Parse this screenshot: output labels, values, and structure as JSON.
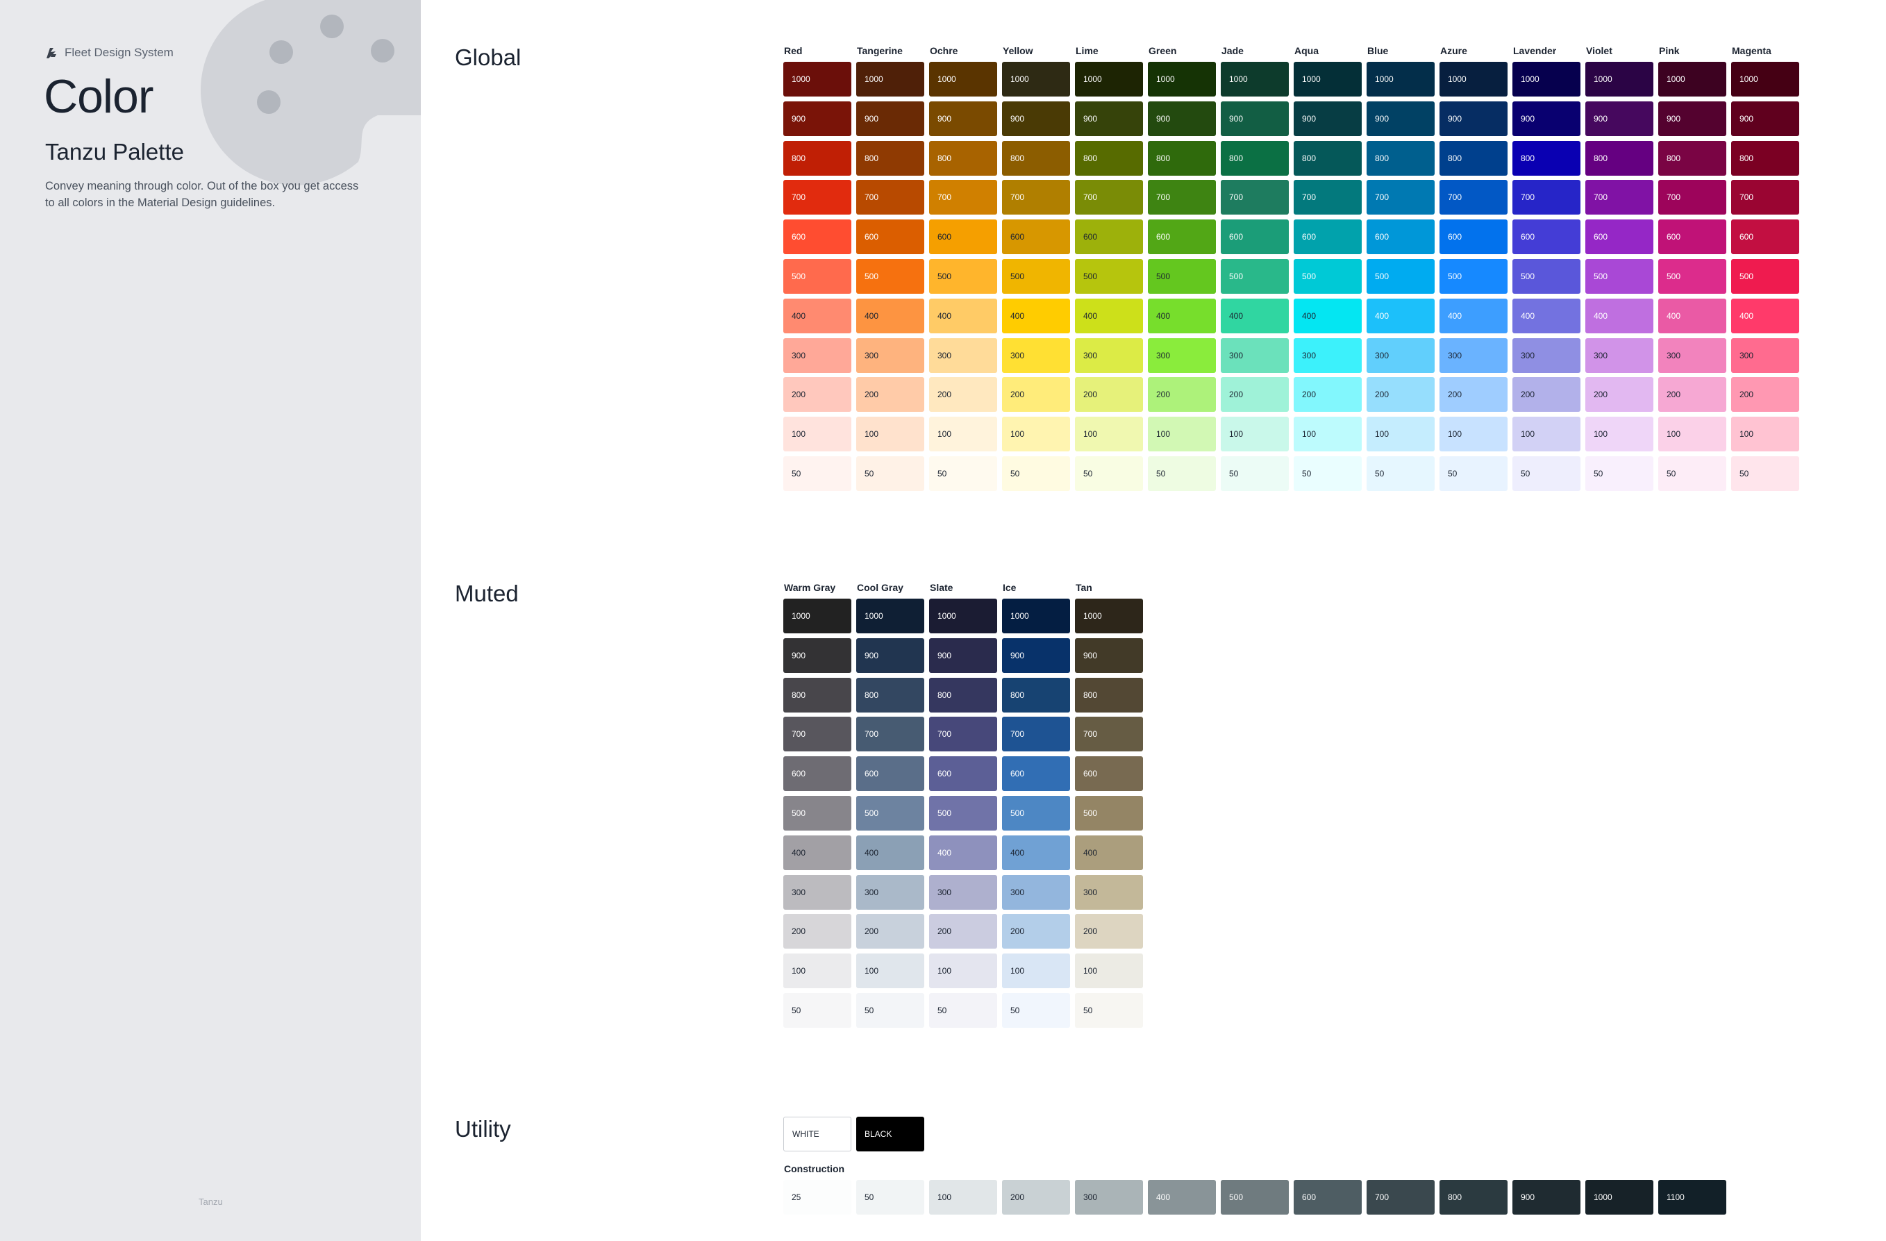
{
  "sidebar": {
    "brand": "Fleet Design System",
    "title": "Color",
    "subtitle": "Tanzu Palette",
    "description": "Convey meaning through color. Out of the box you get access to all colors in the Material Design guidelines.",
    "footer": "Tanzu"
  },
  "sections": {
    "global": "Global",
    "muted": "Muted",
    "utility": "Utility"
  },
  "steps": [
    "1000",
    "900",
    "800",
    "700",
    "600",
    "500",
    "400",
    "300",
    "200",
    "100",
    "50"
  ],
  "global": [
    {
      "name": "Red",
      "colors": [
        "#6b0f0a",
        "#7a1408",
        "#c01f05",
        "#e12b0e",
        "#ff4d30",
        "#ff6a4d",
        "#ff8a70",
        "#ffa898",
        "#ffc8bd",
        "#ffe3dd",
        "#fff3f0"
      ]
    },
    {
      "name": "Tangerine",
      "colors": [
        "#4f2008",
        "#6a2a05",
        "#8f3a02",
        "#b84a00",
        "#db5e00",
        "#f6710f",
        "#fd9441",
        "#feb37e",
        "#ffcba8",
        "#ffe2cd",
        "#fff2e7"
      ]
    },
    {
      "name": "Ochre",
      "colors": [
        "#5a3400",
        "#7a4a00",
        "#a86300",
        "#d08000",
        "#f59f00",
        "#ffb52c",
        "#ffcb66",
        "#ffdb99",
        "#ffe8bf",
        "#fff3dc",
        "#fffaef"
      ]
    },
    {
      "name": "Yellow",
      "colors": [
        "#2e2a14",
        "#4a3a05",
        "#8c5d00",
        "#b07f00",
        "#d79700",
        "#f0b500",
        "#ffcc00",
        "#ffe033",
        "#ffec7a",
        "#fff4b0",
        "#fffbe1"
      ]
    },
    {
      "name": "Lime",
      "colors": [
        "#1d2403",
        "#36430a",
        "#576b00",
        "#7a8c06",
        "#9db10b",
        "#b6c50d",
        "#cde01a",
        "#dceb46",
        "#e6f17a",
        "#f0f8b0",
        "#f9fde3"
      ]
    },
    {
      "name": "Green",
      "colors": [
        "#153305",
        "#234a0f",
        "#2f6a0c",
        "#3e8412",
        "#52a716",
        "#64c71f",
        "#77de2c",
        "#8aec3c",
        "#adf27a",
        "#d2f8b4",
        "#eefce2"
      ]
    },
    {
      "name": "Jade",
      "colors": [
        "#0d3b2c",
        "#125e44",
        "#0b7044",
        "#1e7c5f",
        "#1b9d78",
        "#29b88a",
        "#30d6a1",
        "#6be1bb",
        "#9ff2d8",
        "#c9f8ea",
        "#ecfcf6"
      ]
    },
    {
      "name": "Aqua",
      "colors": [
        "#042f37",
        "#073d44",
        "#055859",
        "#03797d",
        "#01a2ac",
        "#00c9d6",
        "#04e6f2",
        "#3cf1fb",
        "#82f7fd",
        "#bdfbfd",
        "#eafeff"
      ]
    },
    {
      "name": "Blue",
      "colors": [
        "#032e4a",
        "#014164",
        "#005f8e",
        "#0079b2",
        "#0097d8",
        "#00abf0",
        "#1cc0fa",
        "#61cffc",
        "#96defd",
        "#c5edfe",
        "#e6f7ff"
      ]
    },
    {
      "name": "Azure",
      "colors": [
        "#071f3f",
        "#062d63",
        "#00408d",
        "#0258c5",
        "#0272ed",
        "#1689ff",
        "#3d9eff",
        "#6ab3ff",
        "#9fcdff",
        "#c8e2ff",
        "#e8f3ff"
      ]
    },
    {
      "name": "Lavender",
      "colors": [
        "#06004e",
        "#090070",
        "#0a00b2",
        "#2625c8",
        "#443dd6",
        "#5a57da",
        "#7372e0",
        "#8f8fe3",
        "#b2b1ea",
        "#d2d1f5",
        "#eeeefd"
      ]
    },
    {
      "name": "Violet",
      "colors": [
        "#2b0445",
        "#46085e",
        "#650081",
        "#8012a5",
        "#9527c6",
        "#a948d6",
        "#bf6fe0",
        "#d193e8",
        "#e2b8f1",
        "#efd6f8",
        "#f9f0fd"
      ]
    },
    {
      "name": "Pink",
      "colors": [
        "#3d0221",
        "#54022f",
        "#7a0444",
        "#9d045b",
        "#c01277",
        "#dc2c8c",
        "#ea5aa5",
        "#f283bd",
        "#f6a8d3",
        "#fbd1e8",
        "#fdedf7"
      ]
    },
    {
      "name": "Magenta",
      "colors": [
        "#450014",
        "#60001e",
        "#7b0023",
        "#9a0532",
        "#c20f41",
        "#ef1b4f",
        "#ff3a6a",
        "#ff6b8f",
        "#ff98b2",
        "#ffc3d2",
        "#ffe5ec"
      ]
    }
  ],
  "muted": [
    {
      "name": "Warm Gray",
      "colors": [
        "#222222",
        "#333234",
        "#48464b",
        "#58565d",
        "#6e6c73",
        "#87858b",
        "#a2a0a5",
        "#bcbbbf",
        "#d7d6d9",
        "#ebebed",
        "#f6f6f7"
      ]
    },
    {
      "name": "Cool Gray",
      "colors": [
        "#0f1f34",
        "#213550",
        "#334761",
        "#475b72",
        "#5a6e89",
        "#6d83a0",
        "#8ba0b5",
        "#aab9c9",
        "#c8d1dc",
        "#e0e6ec",
        "#f3f5f8"
      ]
    },
    {
      "name": "Slate",
      "colors": [
        "#1b1c33",
        "#2a2b4d",
        "#35375f",
        "#47487a",
        "#5c5f96",
        "#7073a8",
        "#8e91bd",
        "#aeb0ce",
        "#cbcce0",
        "#e4e5ef",
        "#f3f3f8"
      ]
    },
    {
      "name": "Ice",
      "colors": [
        "#041e42",
        "#08326a",
        "#174372",
        "#1e5393",
        "#316eb4",
        "#4d87c4",
        "#70a1d4",
        "#93b6dd",
        "#b3cee9",
        "#d9e6f5",
        "#f1f6fd"
      ]
    },
    {
      "name": "Tan",
      "colors": [
        "#2d261a",
        "#423a28",
        "#534834",
        "#665c44",
        "#786a51",
        "#948565",
        "#ab9e7d",
        "#c3b899",
        "#ddd5c1",
        "#ecebe4",
        "#f7f6f2"
      ]
    }
  ],
  "utility": {
    "white_label": "WHITE",
    "black_label": "BLACK",
    "construction_label": "Construction",
    "construction": [
      {
        "label": "25",
        "color": "#fcfdfd"
      },
      {
        "label": "50",
        "color": "#f1f4f5"
      },
      {
        "label": "100",
        "color": "#e1e6e8"
      },
      {
        "label": "200",
        "color": "#c9d1d4"
      },
      {
        "label": "300",
        "color": "#aab4b7"
      },
      {
        "label": "400",
        "color": "#899498"
      },
      {
        "label": "500",
        "color": "#6f7b7f"
      },
      {
        "label": "600",
        "color": "#4e5d63"
      },
      {
        "label": "700",
        "color": "#3a484e"
      },
      {
        "label": "800",
        "color": "#2b3a40"
      },
      {
        "label": "900",
        "color": "#1f2b31"
      },
      {
        "label": "1000",
        "color": "#172228"
      },
      {
        "label": "1100",
        "color": "#122028"
      }
    ]
  },
  "colors": {
    "sidebar_bg": "#e8e9ec",
    "palette_art": "#d1d3d8",
    "palette_dots": "#b2b6bd",
    "text": "#1b2330"
  }
}
